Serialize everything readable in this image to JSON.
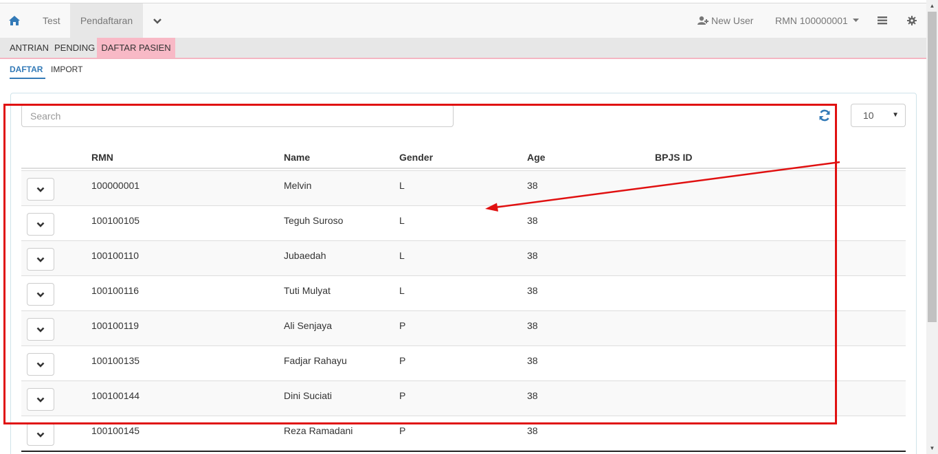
{
  "navbar": {
    "test_label": "Test",
    "pendaftaran_label": "Pendaftaran",
    "new_user_label": "New User",
    "rmn_label": "RMN 100000001"
  },
  "subnav": {
    "antrian": "ANTRIAN",
    "pending": "PENDING",
    "daftar_pasien": "DAFTAR PASIEN"
  },
  "tabs": {
    "daftar": "DAFTAR",
    "import": "IMPORT"
  },
  "search": {
    "placeholder": "Search"
  },
  "page_size": "10",
  "table": {
    "headers": {
      "rmn": "RMN",
      "name": "Name",
      "gender": "Gender",
      "age": "Age",
      "bpjs": "BPJS ID"
    },
    "rows": [
      {
        "rmn": "100000001",
        "name": "Melvin",
        "gender": "L",
        "age": "38",
        "bpjs": ""
      },
      {
        "rmn": "100100105",
        "name": "Teguh Suroso",
        "gender": "L",
        "age": "38",
        "bpjs": ""
      },
      {
        "rmn": "100100110",
        "name": "Jubaedah",
        "gender": "L",
        "age": "38",
        "bpjs": ""
      },
      {
        "rmn": "100100116",
        "name": "Tuti Mulyat",
        "gender": "L",
        "age": "38",
        "bpjs": ""
      },
      {
        "rmn": "100100119",
        "name": "Ali Senjaya",
        "gender": "P",
        "age": "38",
        "bpjs": ""
      },
      {
        "rmn": "100100135",
        "name": "Fadjar Rahayu",
        "gender": "P",
        "age": "38",
        "bpjs": ""
      },
      {
        "rmn": "100100144",
        "name": "Dini Suciati",
        "gender": "P",
        "age": "38",
        "bpjs": ""
      },
      {
        "rmn": "100100145",
        "name": "Reza Ramadani",
        "gender": "P",
        "age": "38",
        "bpjs": ""
      }
    ]
  },
  "colors": {
    "accent": "#337ab7",
    "active_subnav": "#f8b9c6",
    "annotation": "#e01010",
    "refresh_icon": "#337ab7"
  }
}
